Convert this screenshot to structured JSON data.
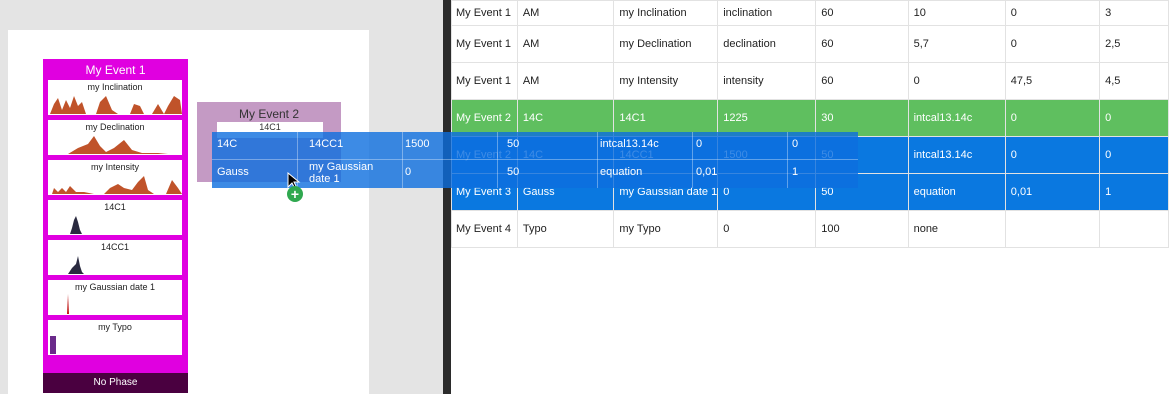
{
  "event1": {
    "title": "My Event 1",
    "dates": [
      {
        "label": "my Inclination"
      },
      {
        "label": "my Declination"
      },
      {
        "label": "my Intensity"
      },
      {
        "label": "14C1"
      },
      {
        "label": "14CC1"
      },
      {
        "label": "my Gaussian date 1"
      },
      {
        "label": "my Typo"
      }
    ],
    "phase": "No Phase"
  },
  "event2": {
    "title": "My Event 2",
    "inner_label": "14C1"
  },
  "table": {
    "rows": [
      {
        "cells": [
          "My Event 1",
          "AM",
          "my Inclination",
          "inclination",
          "60",
          "10",
          "0",
          "3"
        ],
        "state": "normal"
      },
      {
        "cells": [
          "My Event 1",
          "AM",
          "my Declination",
          "declination",
          "60",
          "5,7",
          "0",
          "2,5"
        ],
        "state": "normal"
      },
      {
        "cells": [
          "My Event 1",
          "AM",
          "my Intensity",
          "intensity",
          "60",
          "0",
          "47,5",
          "4,5"
        ],
        "state": "normal"
      },
      {
        "cells": [
          "My Event 2",
          "14C",
          "14C1",
          "1225",
          "30",
          "intcal13.14c",
          "0",
          "0"
        ],
        "state": "green"
      },
      {
        "cells": [
          "My Event 2",
          "14C",
          "14CC1",
          "1500",
          "50",
          "intcal13.14c",
          "0",
          "0"
        ],
        "state": "blue"
      },
      {
        "cells": [
          "My Event 3",
          "Gauss",
          "my Gaussian date 1",
          "0",
          "50",
          "equation",
          "0,01",
          "1"
        ],
        "state": "blue"
      },
      {
        "cells": [
          "My Event 4",
          "Typo",
          "my Typo",
          "0",
          "100",
          "none",
          "",
          ""
        ],
        "state": "normal"
      }
    ]
  },
  "drag_ghost": {
    "row1": [
      "14C",
      "14CC1",
      "1500",
      "50",
      "intcal13.14c",
      "0",
      "0"
    ],
    "row2": [
      "Gauss",
      "my Gaussian date 1",
      "0",
      "50",
      "equation",
      "0,01",
      "1"
    ]
  },
  "colors": {
    "event1": "#e000e0",
    "event2": "#c49ac4",
    "phase": "#4a0040",
    "curve": "#c0532a",
    "row_green": "#5fbf5f",
    "row_blue": "#0a78e0"
  },
  "icons": {
    "cursor": "arrow-cursor-icon",
    "copy": "plus-circle-icon"
  }
}
